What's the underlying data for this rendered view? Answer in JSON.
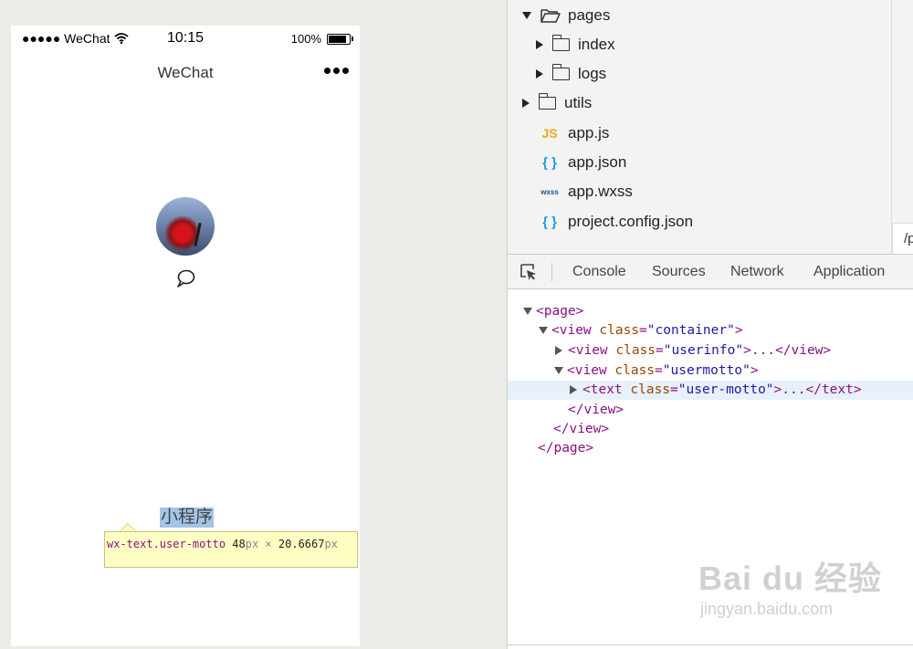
{
  "simulator": {
    "status": {
      "carrier": "●●●●● WeChat",
      "time": "10:15",
      "battery": "100%"
    },
    "navbar": {
      "title": "WeChat"
    },
    "motto": "小程序",
    "inspect_tooltip": {
      "selector": "wx-text.user-motto",
      "width": "48",
      "unit": "px",
      "times": "×",
      "height": "20.6667"
    }
  },
  "file_tree": {
    "items": [
      {
        "label": "pages",
        "kind": "folder"
      },
      {
        "label": "index",
        "kind": "folder"
      },
      {
        "label": "logs",
        "kind": "folder"
      },
      {
        "label": "utils",
        "kind": "folder"
      },
      {
        "label": "app.js",
        "kind": "js",
        "icon": "JS"
      },
      {
        "label": "app.json",
        "kind": "json",
        "icon": "{ }"
      },
      {
        "label": "app.wxss",
        "kind": "wxss",
        "icon": "wxss"
      },
      {
        "label": "project.config.json",
        "kind": "json",
        "icon": "{ }"
      }
    ],
    "path_fragment": "/p"
  },
  "devtools": {
    "tabs": [
      "Console",
      "Sources",
      "Network",
      "Application"
    ],
    "dom": {
      "lines": [
        {
          "tag": "page",
          "open": "<page>"
        },
        {
          "tag": "view",
          "attr": "class",
          "value": "\"container\""
        },
        {
          "tag": "view",
          "attr": "class",
          "value": "\"userinfo\"",
          "dots": "...",
          "close": "</view>"
        },
        {
          "tag": "view",
          "attr": "class",
          "value": "\"usermotto\""
        },
        {
          "tag": "text",
          "attr": "class",
          "value": "\"user-motto\"",
          "dots": "...",
          "close": "</text>"
        },
        {
          "close": "</view>"
        },
        {
          "close": "</view>"
        },
        {
          "close": "</page>"
        }
      ]
    }
  },
  "watermark": {
    "main": "Bai du 经验",
    "sub": "jingyan.baidu.com"
  }
}
